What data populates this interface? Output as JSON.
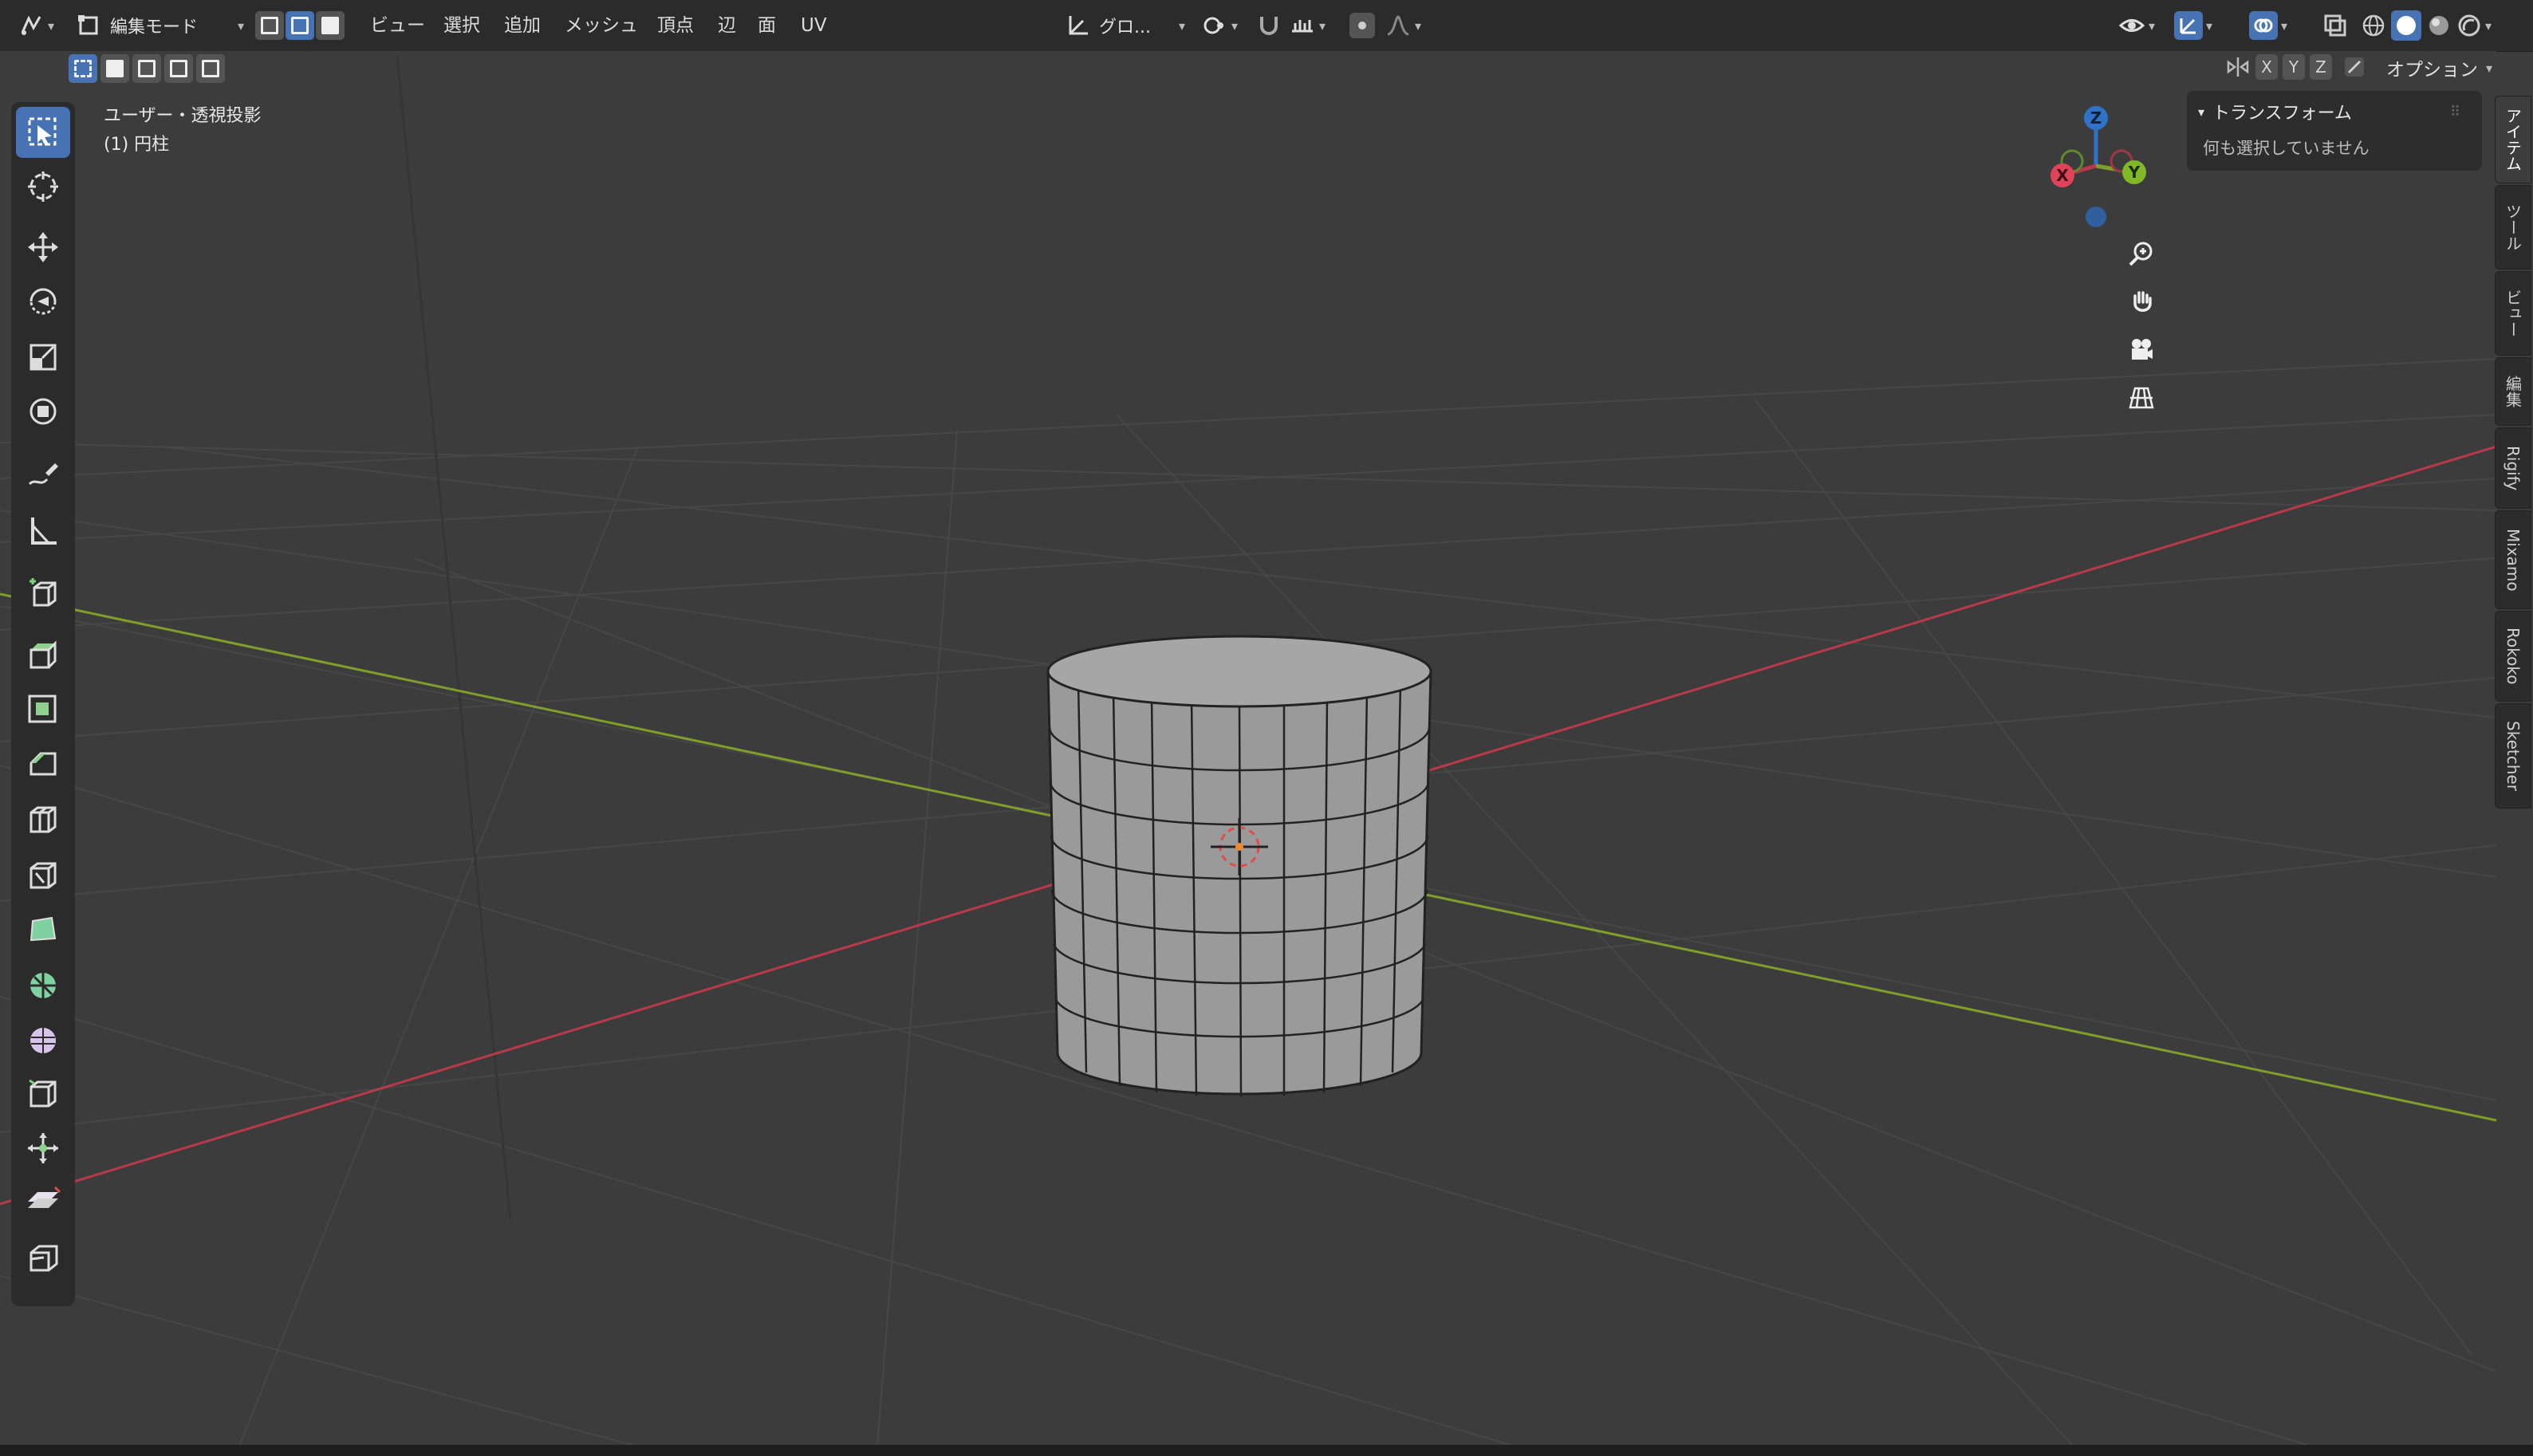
{
  "header": {
    "mode_label": "編集モード",
    "menu": [
      "ビュー",
      "選択",
      "追加",
      "メッシュ",
      "頂点",
      "辺",
      "面",
      "UV"
    ],
    "transform_orientation": "グロ...",
    "options_label": "オプション",
    "axis_x": "X",
    "axis_y": "Y",
    "axis_z": "Z"
  },
  "viewport": {
    "view_name": "ユーザー・透視投影",
    "object_name": "(1) 円柱"
  },
  "gizmo": {
    "x": "X",
    "y": "Y",
    "z": "Z"
  },
  "npanel": {
    "section_title": "トランスフォーム",
    "empty_message": "何も選択していません"
  },
  "tabs": [
    "アイテム",
    "ツール",
    "ビュー",
    "編集",
    "Rigify",
    "Mixamo",
    "Rokoko",
    "Sketcher"
  ],
  "colors": {
    "accent": "#4772b3",
    "x_axis": "#b83a4a",
    "y_axis": "#7f9e2b",
    "z_axis": "#2f73c9",
    "grid": "#474747"
  },
  "tools": [
    "select-box",
    "cursor",
    "move",
    "rotate",
    "scale",
    "transform",
    "annotate",
    "measure",
    "add-cube",
    "extrude",
    "inset",
    "bevel",
    "loop-cut",
    "knife",
    "poly-build",
    "spin",
    "smooth",
    "edge-slide",
    "shrink-fatten",
    "shear",
    "rip-region"
  ]
}
